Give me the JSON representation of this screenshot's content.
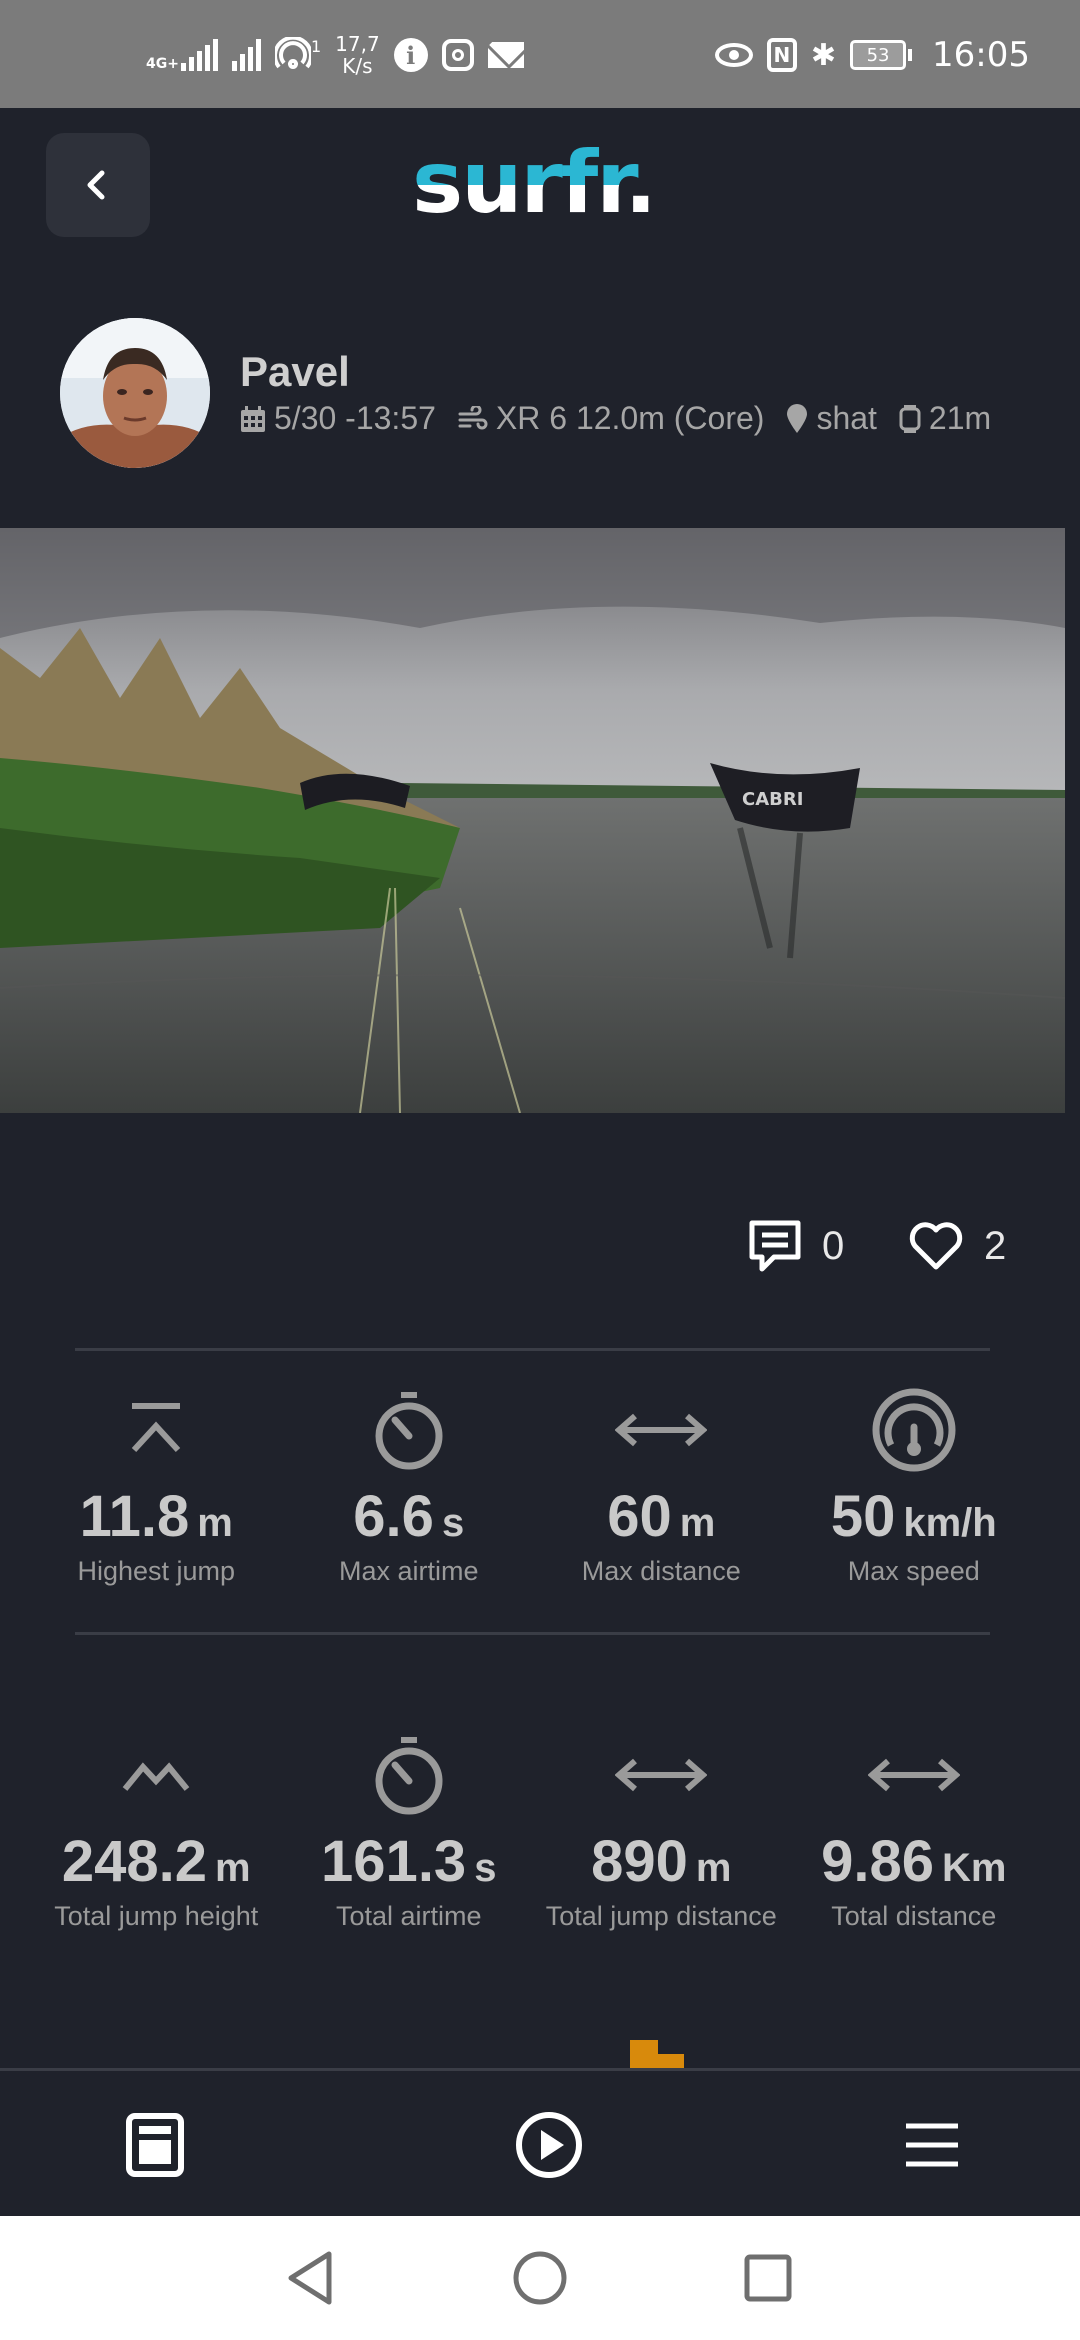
{
  "status_bar": {
    "network_label": "4G+",
    "sim_index": "1",
    "net_speed_value": "17,7",
    "net_speed_unit": "K/s",
    "nfc_label": "N",
    "battery": "53",
    "time": "16:05"
  },
  "header": {
    "app_name": "surfr.",
    "back_icon": "chevron-left-icon"
  },
  "session": {
    "user_name": "Pavel",
    "date": "5/30 -13:57",
    "kite": "XR 6 12.0m (Core)",
    "location": "shat",
    "duration": "21m"
  },
  "social": {
    "comments_count": "0",
    "likes_count": "2"
  },
  "stats_top": [
    {
      "icon": "jump-height-icon",
      "value": "11.8",
      "unit": "m",
      "label": "Highest jump"
    },
    {
      "icon": "timer-icon",
      "value": "6.6",
      "unit": "s",
      "label": "Max airtime"
    },
    {
      "icon": "distance-arrows-icon",
      "value": "60",
      "unit": "m",
      "label": "Max distance"
    },
    {
      "icon": "speedometer-icon",
      "value": "50",
      "unit": "km/h",
      "label": "Max speed"
    }
  ],
  "stats_bottom": [
    {
      "icon": "jumps-icon",
      "value": "248.2",
      "unit": "m",
      "label": "Total jump height"
    },
    {
      "icon": "timer-icon",
      "value": "161.3",
      "unit": "s",
      "label": "Total airtime"
    },
    {
      "icon": "distance-arrows-icon",
      "value": "890",
      "unit": "m",
      "label": "Total jump distance"
    },
    {
      "icon": "distance-arrows-icon",
      "value": "9.86",
      "unit": "Km",
      "label": "Total distance"
    }
  ],
  "colors": {
    "background": "#1f222b",
    "accent": "#2bb7d3",
    "orange": "#d88a0c"
  }
}
